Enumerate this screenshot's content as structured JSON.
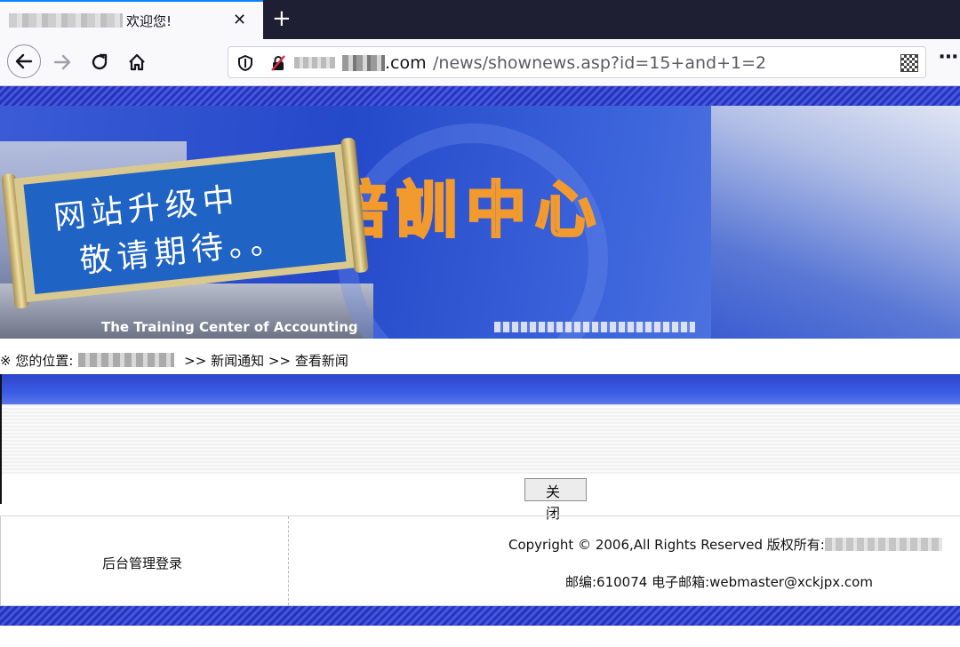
{
  "browser": {
    "tab_title": "欢迎您!",
    "tab_close": "✕",
    "new_tab": "+",
    "url_host": ".com",
    "url_path": "/news/shownews.asp?id=15+and+1=2"
  },
  "banner": {
    "title": "會計培訓中心",
    "scroll_line1": "网站升级中",
    "scroll_line2": "敬请期待。。",
    "subtitle": "The Training Center of Accounting"
  },
  "breadcrumb": {
    "prefix": "※ 您的位置:",
    "sep1": ">>",
    "item1": "新闻通知",
    "sep2": ">>",
    "item2": "查看新闻"
  },
  "close_button": "关 闭",
  "footer": {
    "admin_login": "后台管理登录",
    "copyright": "Copyright © 2006,All Rights Reserved 版权所有:",
    "postal": "邮编:610074 电子邮箱:webmaster@xckjpx.com"
  },
  "colors": {
    "stripe": "#2734b6",
    "banner_blue": "#2449c9",
    "banner_title_outline": "#f29a2e",
    "tab_accent": "#0a84ff"
  }
}
